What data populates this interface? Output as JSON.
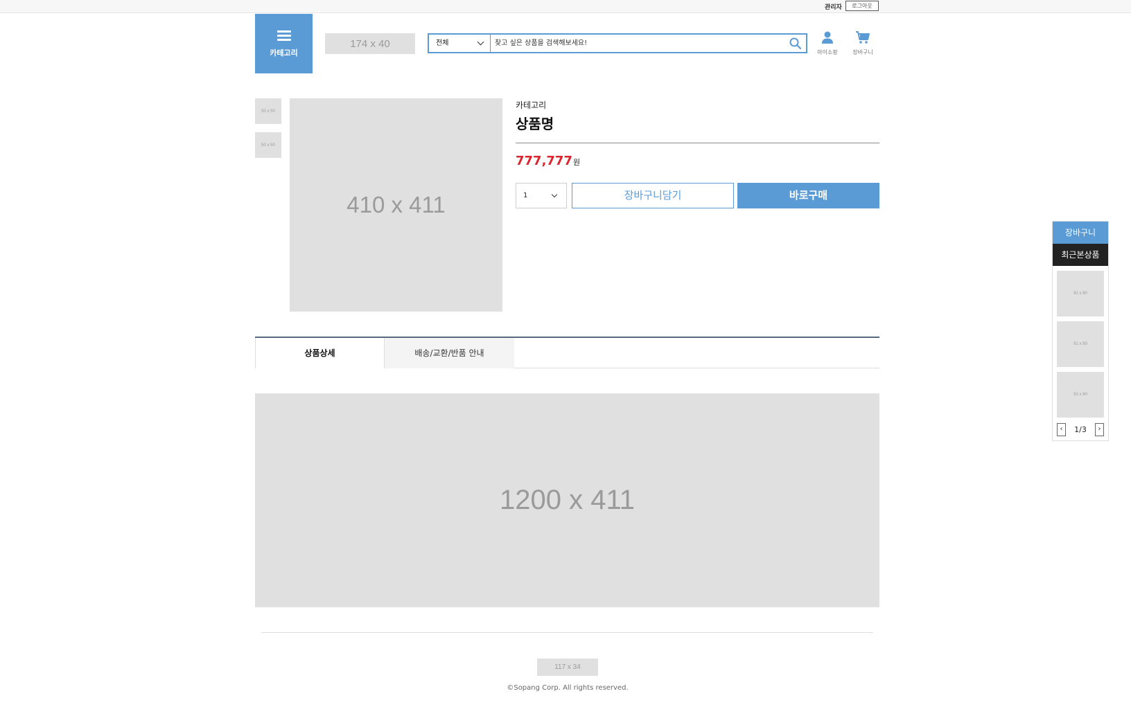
{
  "topbar": {
    "admin_label": "관리자",
    "logout_label": "로그아웃"
  },
  "header": {
    "category_label": "카테고리",
    "logo_placeholder": "174 x 40",
    "search": {
      "scope_value": "전체",
      "placeholder": "찾고 싶은 상품을 검색해보세요!"
    },
    "mypage_label": "마이소팡",
    "cart_label": "장바구니"
  },
  "product": {
    "thumbnails": [
      "50 x 50",
      "50 x 50"
    ],
    "main_image": "410 x 411",
    "category": "카테고리",
    "name": "상품명",
    "price": "777,777",
    "currency": "원",
    "quantity": "1",
    "add_to_cart_label": "장바구니담기",
    "buy_now_label": "바로구매"
  },
  "tabs": [
    {
      "label": "상품상세",
      "active": true
    },
    {
      "label": "배송/교환/반품 안내",
      "active": false
    }
  ],
  "detail_image": "1200 x 411",
  "footer": {
    "logo_placeholder": "117 x 34",
    "copyright": "©Sopang Corp. All rights reserved."
  },
  "side_panel": {
    "cart_label": "장바구니",
    "recent_label": "최근본상품",
    "recent_items": [
      "91 x 90",
      "91 x 90",
      "91 x 90"
    ],
    "page_indicator": "1/3",
    "prev_glyph": "‹",
    "next_glyph": "›"
  },
  "colors": {
    "accent": "#5b9bd5",
    "price": "#d9262f",
    "dark": "#222222",
    "placeholder": "#e0e0e0"
  }
}
